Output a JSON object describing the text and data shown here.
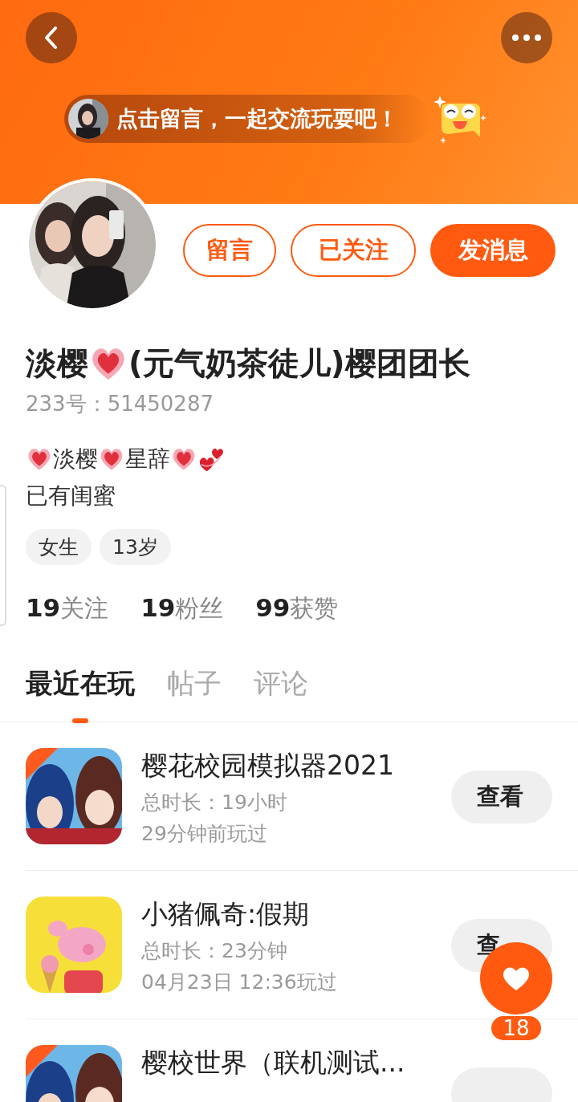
{
  "header": {
    "banner_text": "点击留言，一起交流玩耍吧！"
  },
  "profile": {
    "buttons": [
      {
        "label": "留言",
        "kind": "outline"
      },
      {
        "label": "已关注",
        "kind": "outline"
      },
      {
        "label": "发消息",
        "kind": "filled"
      }
    ],
    "name": [
      {
        "kind": "text",
        "text": "淡樱"
      },
      {
        "kind": "heart"
      },
      {
        "kind": "text",
        "text": "(元气奶茶徒儿)樱团团长"
      }
    ],
    "id_text": "233号：51450287",
    "bio": [
      [
        {
          "kind": "heart"
        },
        {
          "kind": "text",
          "text": "淡樱"
        },
        {
          "kind": "heart"
        },
        {
          "kind": "text",
          "text": "星辞"
        },
        {
          "kind": "heart"
        },
        {
          "kind": "hearts"
        }
      ],
      [
        {
          "kind": "text",
          "text": "已有闺蜜"
        }
      ]
    ],
    "tags": [
      "女生",
      "13岁"
    ],
    "stats": [
      {
        "count": "19",
        "label": "关注"
      },
      {
        "count": "19",
        "label": "粉丝"
      },
      {
        "count": "99",
        "label": "获赞"
      }
    ]
  },
  "tabs": [
    {
      "label": "最近在玩",
      "selected": true
    },
    {
      "label": "帖子",
      "selected": false
    },
    {
      "label": "评论",
      "selected": false
    }
  ],
  "games": [
    {
      "title": "樱花校园模拟器2021",
      "meta": [
        "总时长：19小时",
        "29分钟前玩过"
      ],
      "button": "查看"
    },
    {
      "title": "小猪佩奇:假期",
      "meta": [
        "总时长：23分钟",
        "04月23日 12:36玩过"
      ],
      "button": "查"
    },
    {
      "title": "樱校世界（联机测试..."
    }
  ],
  "like": {
    "count": "18"
  }
}
